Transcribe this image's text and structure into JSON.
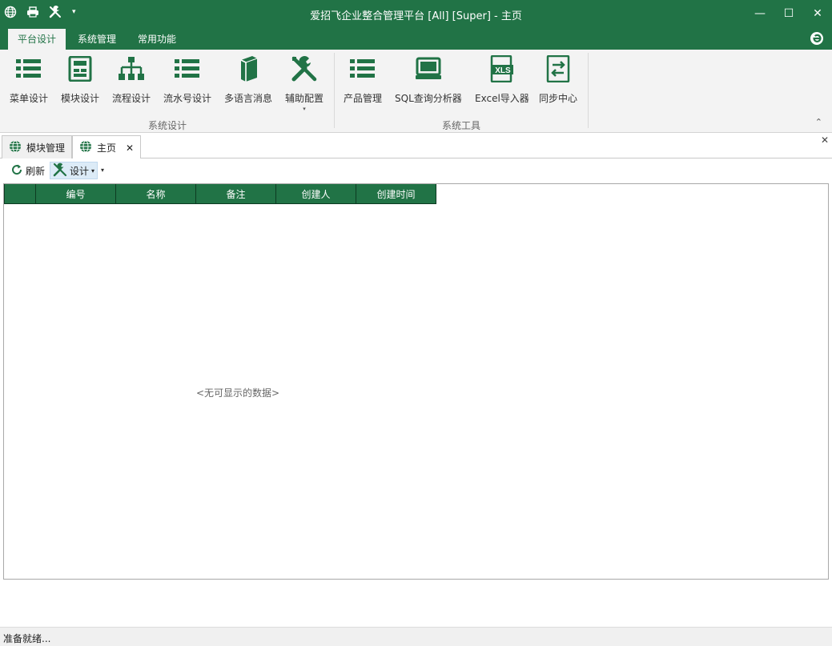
{
  "window": {
    "title": "爱招飞企业整合管理平台 [All] [Super] - 主页",
    "controls": {
      "minimize": "—",
      "maximize": "☐",
      "close": "✕"
    },
    "qat_arrow": "▾"
  },
  "ribbon_tabs": [
    "平台设计",
    "系统管理",
    "常用功能"
  ],
  "ribbon": {
    "groups": [
      {
        "label": "系统设计",
        "buttons": [
          {
            "label": "菜单设计",
            "icon": "list-icon"
          },
          {
            "label": "模块设计",
            "icon": "module-icon"
          },
          {
            "label": "流程设计",
            "icon": "flowchart-icon"
          },
          {
            "label": "流水号设计",
            "icon": "list-icon"
          },
          {
            "label": "多语言消息",
            "icon": "book-icon"
          },
          {
            "label": "辅助配置",
            "icon": "tools-icon",
            "dropdown": "▾"
          }
        ]
      },
      {
        "label": "系统工具",
        "buttons": [
          {
            "label": "产品管理",
            "icon": "list-icon"
          },
          {
            "label": "SQL查询分析器",
            "icon": "terminal-icon"
          },
          {
            "label": "Excel导入器",
            "icon": "xls-icon",
            "icon_text": "XLS"
          },
          {
            "label": "同步中心",
            "icon": "sync-icon"
          }
        ]
      }
    ],
    "collapse": "⌃"
  },
  "doc_tabs": [
    {
      "label": "模块管理",
      "icon": "globe-icon",
      "active": false
    },
    {
      "label": "主页",
      "icon": "globe-icon",
      "active": true,
      "close": "✕"
    }
  ],
  "panel_close": "✕",
  "toolbar": {
    "refresh_label": "刷新",
    "design_label": "设计",
    "design_caret": "▾",
    "overflow": "▾"
  },
  "grid": {
    "columns": [
      "",
      "编号",
      "名称",
      "备注",
      "创建人",
      "创建时间"
    ],
    "empty_text": "<无可显示的数据>"
  },
  "status": "准备就绪...",
  "colors": {
    "accent": "#217346"
  }
}
